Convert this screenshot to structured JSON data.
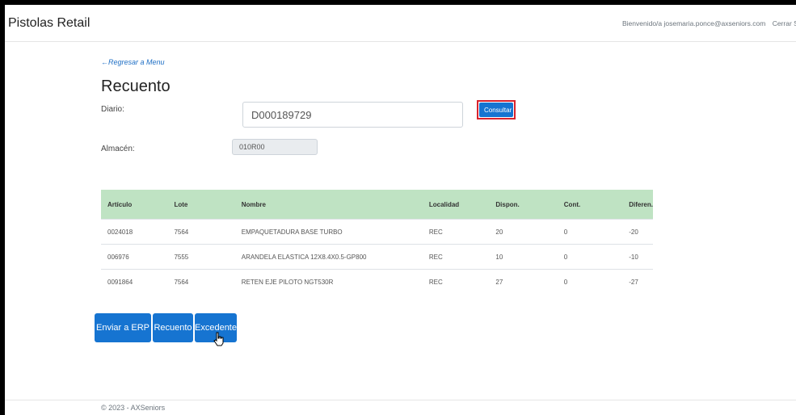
{
  "app": {
    "brand": "Pistolas Retail",
    "welcome": "Bienvenido/a josemaria.ponce@axseniors.com",
    "logout": "Cerrar Sesión"
  },
  "page": {
    "back_link": "←Regresar a Menu",
    "title": "Recuento",
    "diario_label": "Diario:",
    "diario_value": "D000189729",
    "consultar_label": "Consultar",
    "almacen_label": "Almacén:",
    "almacen_value": "010R00"
  },
  "table": {
    "headers": [
      "Artículo",
      "Lote",
      "Nombre",
      "Localidad",
      "Dispon.",
      "Cont.",
      "Diferen."
    ],
    "rows": [
      [
        "0024018",
        "7564",
        "EMPAQUETADURA BASE TURBO",
        "REC",
        "20",
        "0",
        "-20"
      ],
      [
        "006976",
        "7555",
        "ARANDELA ELASTICA 12X8.4X0.5-GP800",
        "REC",
        "10",
        "0",
        "-10"
      ],
      [
        "0091864",
        "7564",
        "RETEN EJE PILOTO NGT530R",
        "REC",
        "27",
        "0",
        "-27"
      ]
    ]
  },
  "actions": {
    "enviar_erp": "Enviar a ERP",
    "recuento": "Recuento",
    "excedente": "Excedente"
  },
  "footer": "© 2023 - AXSeniors",
  "colors": {
    "primary": "#1674d1",
    "table_header": "#bfe3c3",
    "highlight": "#d9232d"
  }
}
